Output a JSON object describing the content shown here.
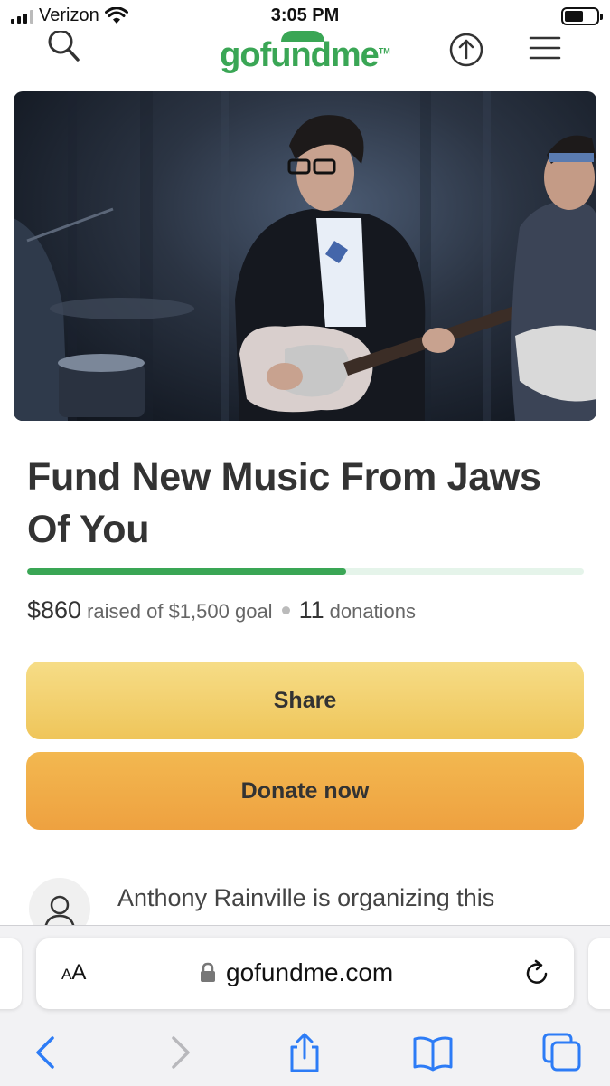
{
  "status_bar": {
    "carrier": "Verizon",
    "time": "3:05 PM"
  },
  "header": {
    "logo": "gofundme",
    "logo_tm": "TM"
  },
  "campaign": {
    "title": "Fund New Music From Jaws Of You",
    "raised": "$860",
    "goal_text": "raised of $1,500 goal",
    "donations_count": "11",
    "donations_label": "donations",
    "progress_fraction": 0.573
  },
  "buttons": {
    "share": "Share",
    "donate": "Donate now"
  },
  "organizer": {
    "text": "Anthony Rainville is organizing this fundraiser"
  },
  "browser": {
    "reader_label_small": "A",
    "reader_label_large": "A",
    "url": "gofundme.com"
  },
  "colors": {
    "brand_green": "#3aa655",
    "share_yellow": "#f2d06d",
    "donate_orange": "#f0ad47",
    "safari_blue": "#2d7cf6"
  },
  "icons": {
    "header": [
      "search-icon",
      "upload-share-icon",
      "hamburger-menu-icon"
    ],
    "toolbar": [
      "back-chevron-icon",
      "forward-chevron-icon",
      "share-icon",
      "bookmarks-icon",
      "tabs-icon"
    ]
  }
}
